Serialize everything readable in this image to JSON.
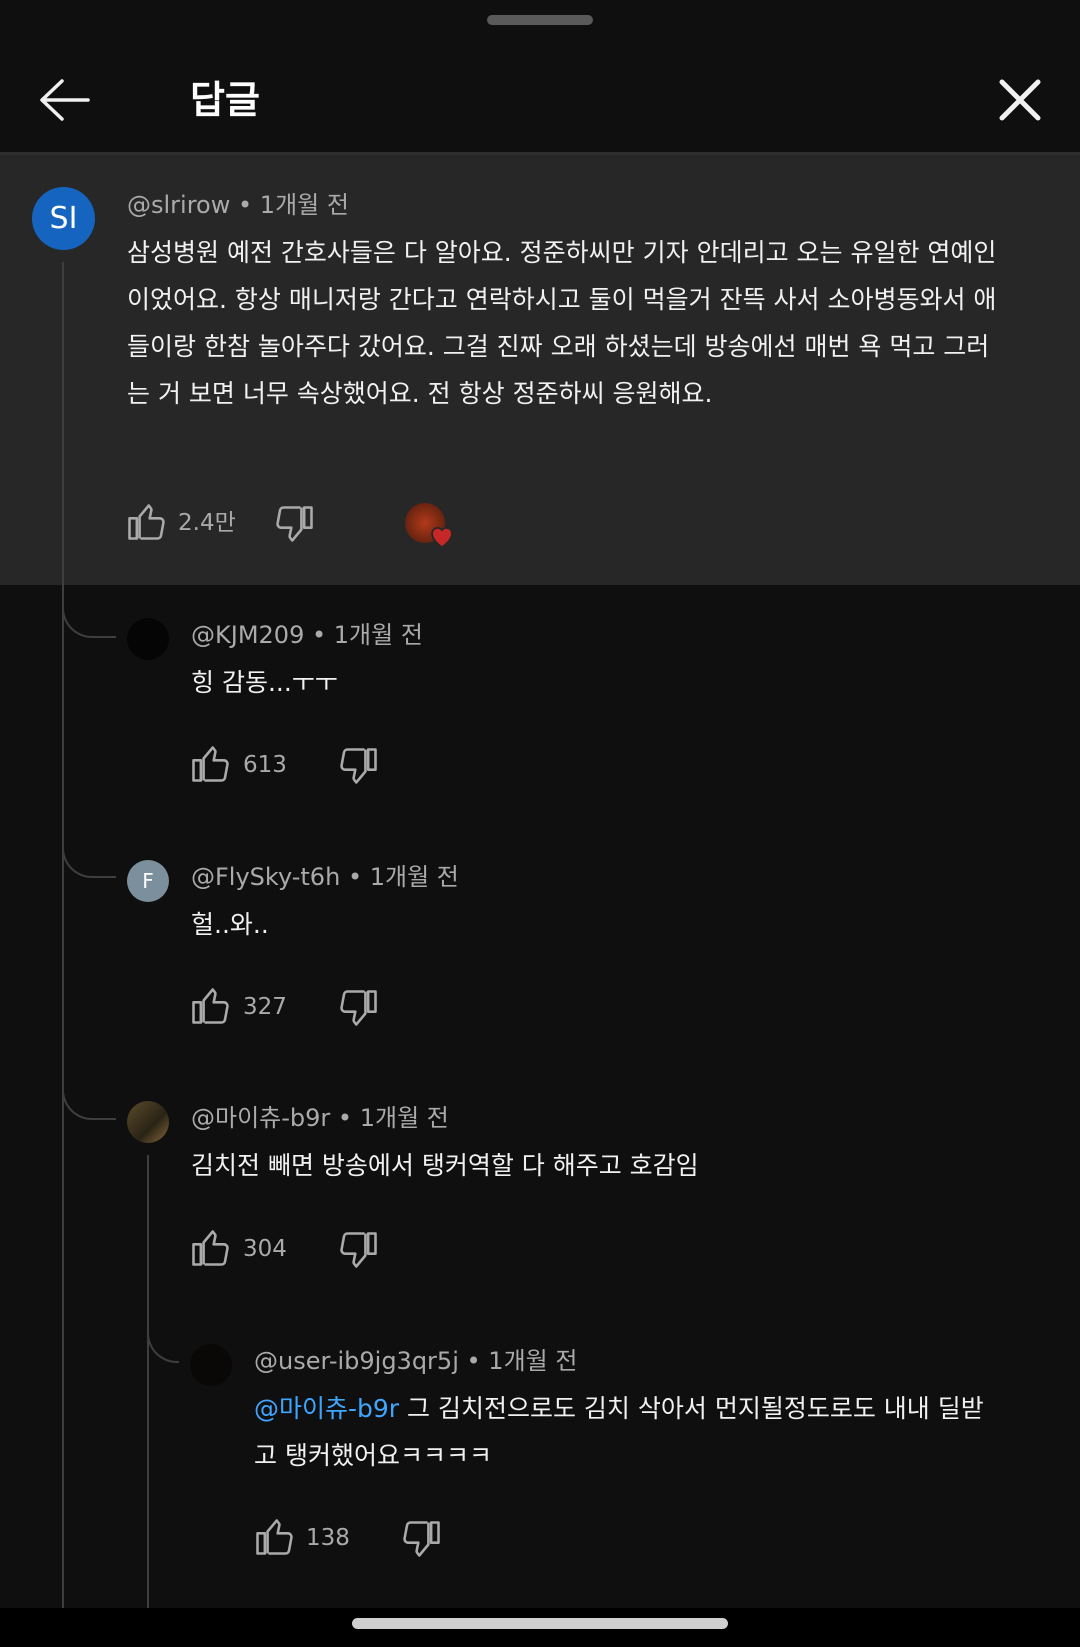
{
  "header": {
    "title": "답글"
  },
  "parent": {
    "avatar_initials": "SI",
    "author": "@slrirow",
    "time": "1개월 전",
    "text": "삼성병원 예전 간호사들은 다 알아요. 정준하씨만 기자 안데리고 오는 유일한 연예인이었어요. 항상 매니저랑 간다고 연락하시고 둘이 먹을거 잔뜩 사서 소아병동와서 애들이랑 한참 놀아주다 갔어요. 그걸 진짜 오래 하셨는데 방송에선 매번 욕 먹고 그러는 거 보면 너무 속상했어요. 전 항상 정준하씨 응원해요.",
    "likes": "2.4만"
  },
  "replies": [
    {
      "author": "@KJM209",
      "time": "1개월 전",
      "text": "힝 감동...ㅜㅜ",
      "likes": "613"
    },
    {
      "avatar_initials": "F",
      "author": "@FlySky-t6h",
      "time": "1개월 전",
      "text": "헐..와..",
      "likes": "327"
    },
    {
      "author": "@마이츄-b9r",
      "time": "1개월 전",
      "text": "김치전 빼면 방송에서 탱커역할 다 해주고 호감임",
      "likes": "304"
    }
  ],
  "nested_reply": {
    "author": "@user-ib9jg3qr5j",
    "time": "1개월 전",
    "mention": "@마이츄-b9r",
    "text": "그 김치전으로도 김치 삭아서 먼지될정도로도 내내 딜받고 탱커했어요ㅋㅋㅋㅋ",
    "likes": "138"
  },
  "colors": {
    "accent": "#3ea6ff",
    "background": "#0f0f0f",
    "highlight": "#272727"
  },
  "icons": [
    "back-arrow-icon",
    "close-icon",
    "like-icon",
    "dislike-icon",
    "creator-heart-icon"
  ]
}
